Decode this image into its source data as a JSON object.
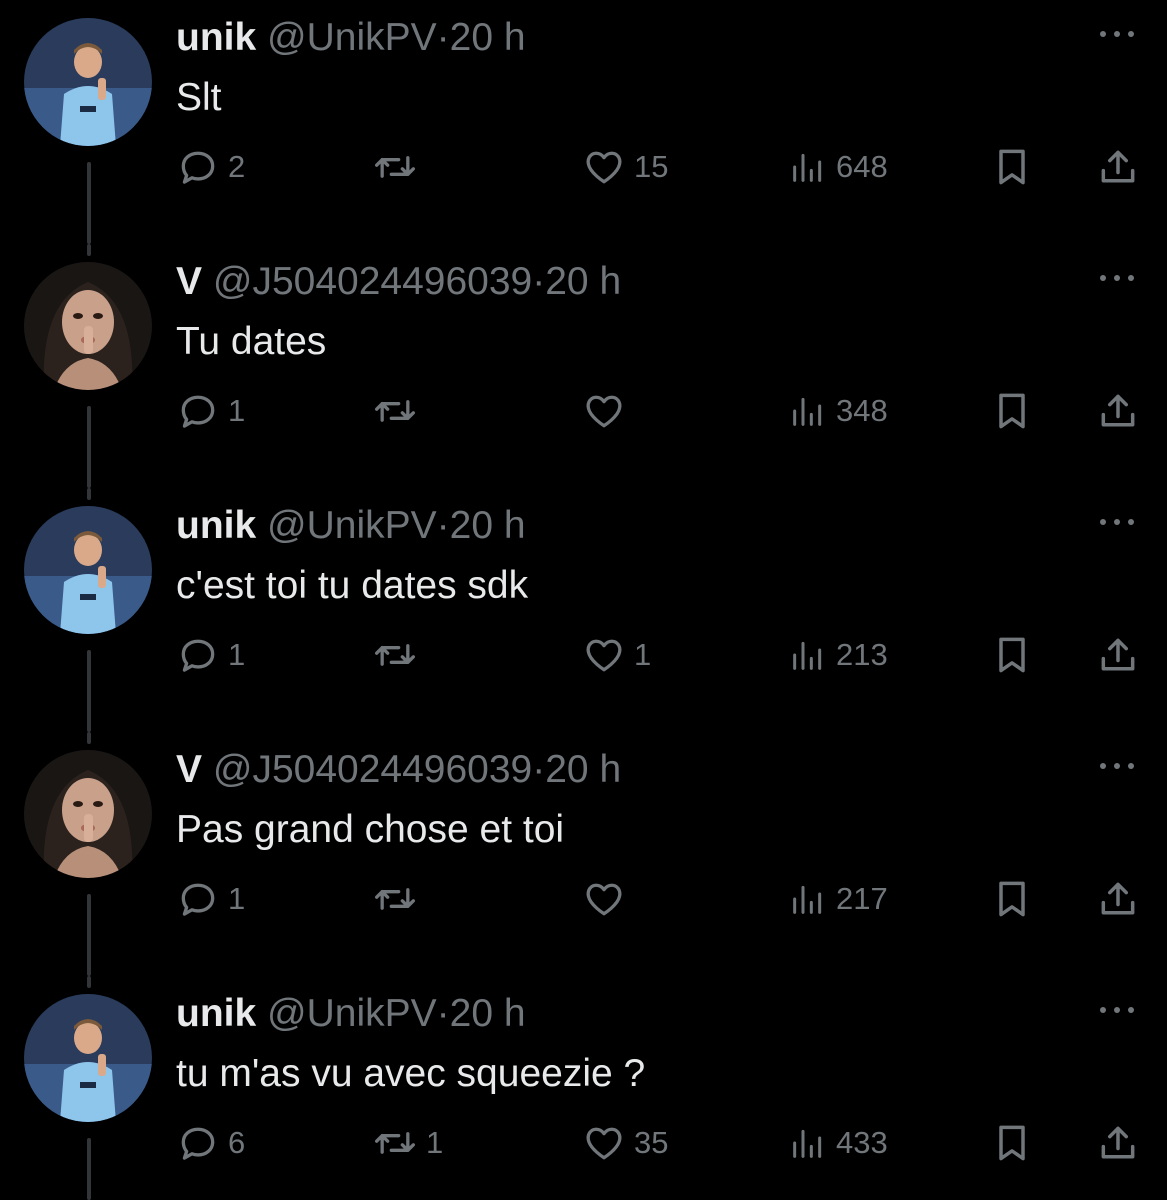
{
  "colors": {
    "background": "#000000",
    "text_primary": "#e7e9ea",
    "text_secondary": "#71767b",
    "thread_line": "#333639"
  },
  "icons": {
    "reply": "speech-bubble-icon",
    "retweet": "retweet-arrows-icon",
    "like": "heart-icon",
    "views": "bar-chart-icon",
    "bookmark": "bookmark-icon",
    "share": "share-upload-icon",
    "more": "ellipsis-icon"
  },
  "tweets": [
    {
      "display_name": "unik",
      "handle": "@UnikPV",
      "separator": "·",
      "time": "20 h",
      "text": "Slt",
      "replies": "2",
      "retweets": "",
      "likes": "15",
      "views": "648"
    },
    {
      "display_name": "V",
      "handle": "@J504024496039",
      "separator": "·",
      "time": "20 h",
      "text": "Tu dates",
      "replies": "1",
      "retweets": "",
      "likes": "",
      "views": "348"
    },
    {
      "display_name": "unik",
      "handle": "@UnikPV",
      "separator": "·",
      "time": "20 h",
      "text": "c'est toi tu dates sdk",
      "replies": "1",
      "retweets": "",
      "likes": "1",
      "views": "213"
    },
    {
      "display_name": "V",
      "handle": "@J504024496039",
      "separator": "·",
      "time": "20 h",
      "text": "Pas grand chose et toi",
      "replies": "1",
      "retweets": "",
      "likes": "",
      "views": "217"
    },
    {
      "display_name": "unik",
      "handle": "@UnikPV",
      "separator": "·",
      "time": "20 h",
      "text": "tu m'as vu avec squeezie ?",
      "replies": "6",
      "retweets": "1",
      "likes": "35",
      "views": "433"
    }
  ]
}
